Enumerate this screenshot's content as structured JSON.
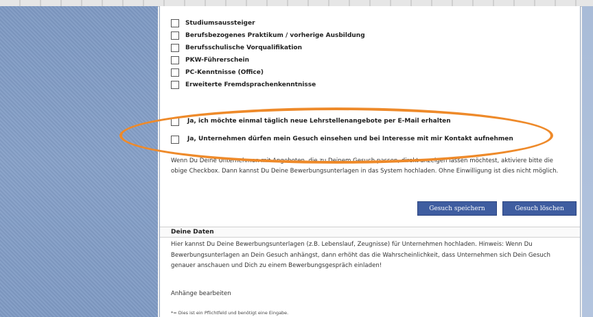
{
  "qualifications": [
    {
      "label": "Studiumsaussteiger",
      "checked": false
    },
    {
      "label": "Berufsbezogenes Praktikum / vorherige Ausbildung",
      "checked": false
    },
    {
      "label": "Berufsschulische Vorqualifikation",
      "checked": false
    },
    {
      "label": "PKW-Führerschein",
      "checked": false
    },
    {
      "label": "PC-Kenntnisse (Office)",
      "checked": false
    },
    {
      "label": "Erweiterte Fremdsprachenkenntnisse",
      "checked": false
    }
  ],
  "consent": {
    "email_label": "Ja, ich möchte einmal täglich neue Lehrstellenangebote per E-Mail erhalten",
    "contact_label": "Ja, Unternehmen dürfen mein Gesuch einsehen und bei Interesse mit mir Kontakt aufnehmen"
  },
  "info_text": "Wenn Du Deine Unternehmen mit Angeboten, die zu Deinem Gesuch passen, direkt anzeigen lassen möchtest, aktiviere bitte die obige Checkbox. Dann kannst Du Deine Bewerbungsunterlagen in das System hochladen. Ohne Einwilligung ist dies nicht möglich.",
  "buttons": {
    "save": "Gesuch speichern",
    "delete": "Gesuch löschen"
  },
  "data_section": {
    "title": "Deine Daten",
    "text": "Hier kannst Du Deine Bewerbungsunterlagen (z.B. Lebenslauf, Zeugnisse) für Unternehmen hochladen. Hinweis: Wenn Du Bewerbungsunterlagen an Dein Gesuch anhängst, dann erhöht das die Wahrscheinlichkeit, dass Unternehmen sich Dein Gesuch genauer anschauen und Dich zu einem Bewerbungsgespräch einladen!",
    "attachments_link": "Anhänge bearbeiten",
    "footnote": "*= Dies ist ein Pflichtfeld und benötigt eine Eingabe."
  },
  "colors": {
    "highlight": "#ee8a2a",
    "button": "#3f5da0",
    "background": "#86a0c8"
  }
}
